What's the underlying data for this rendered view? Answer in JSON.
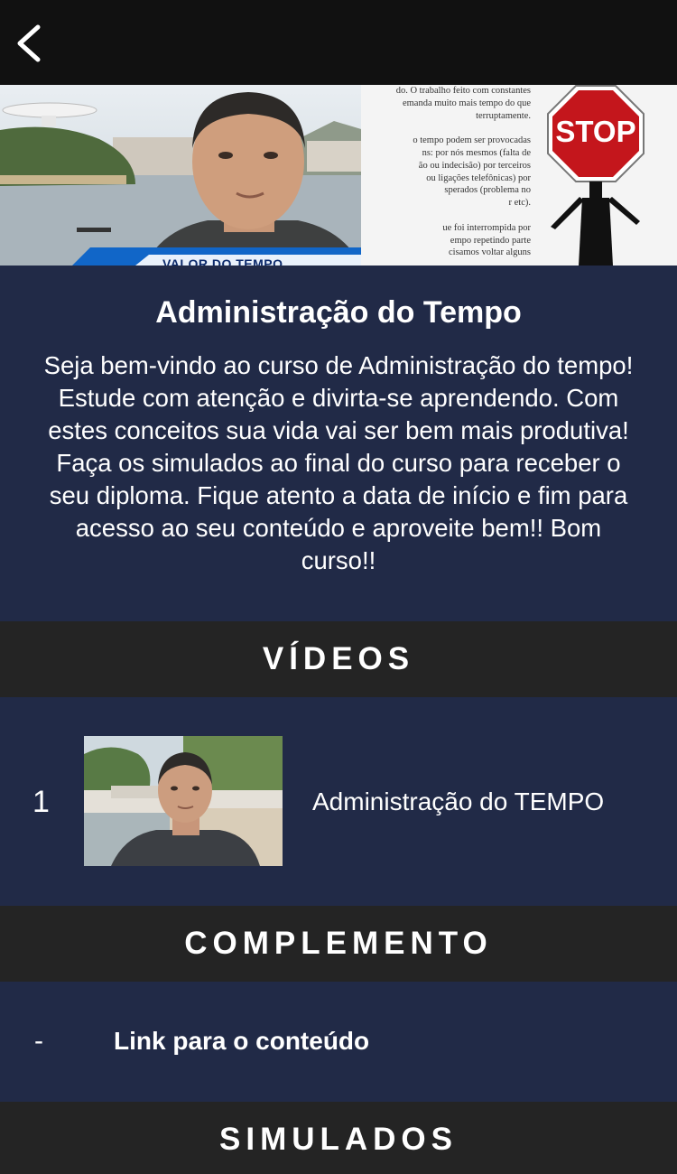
{
  "topbar": {
    "back_icon": "chevron-left-icon"
  },
  "hero": {
    "slide_text": "do. O trabalho feito com constantes\nemanda muito mais tempo do que\nterruptamente.\n\no tempo podem ser provocadas\nns: por nós mesmos (falta de\não ou indecisão) por terceiros\nou ligações telefônicas) por\nsperados (problema no\nr etc).\n\nue foi interrompida por\nempo repetindo parte\ncisamos voltar alguns",
    "stop_sign": "STOP",
    "lower_third": "VALOR DO TEMPO"
  },
  "course": {
    "title": "Administração do Tempo",
    "description": "Seja bem-vindo ao curso de Administração do tempo! Estude com atenção e divirta-se aprendendo. Com estes conceitos sua vida vai ser bem mais produtiva!  Faça os simulados ao final do curso para receber o seu diploma. Fique atento a data de início e fim para acesso ao seu conteúdo e aproveite bem!! Bom curso!!"
  },
  "sections": {
    "videos": "VÍDEOS",
    "complemento": "COMPLEMENTO",
    "simulados": "SIMULADOS"
  },
  "videos": [
    {
      "number": "1",
      "title": "Administração do TEMPO"
    }
  ],
  "complemento": [
    {
      "bullet": "-",
      "label": "Link para o conteúdo"
    }
  ],
  "colors": {
    "background": "#212a47",
    "header": "#242424",
    "topbar": "#111111",
    "stop_red": "#c4161c"
  }
}
